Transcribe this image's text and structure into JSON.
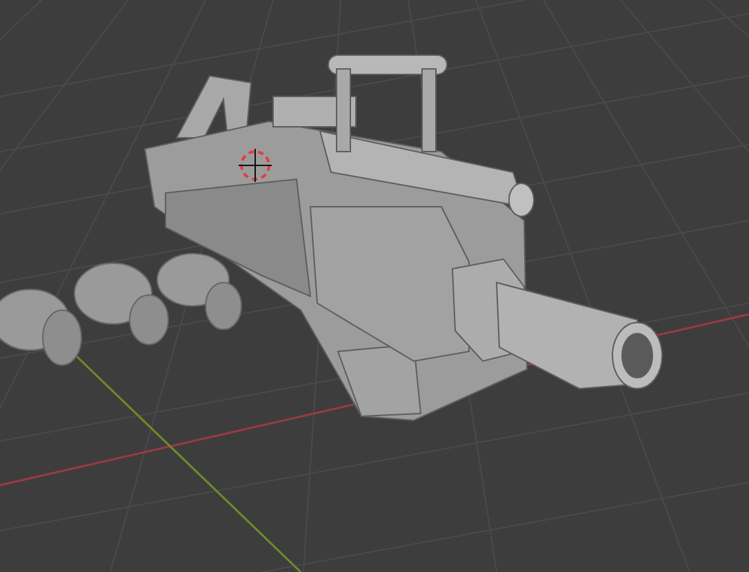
{
  "viewport": {
    "axes": [
      {
        "kind": "x",
        "color": "#9a3a42"
      },
      {
        "kind": "y",
        "color": "#6e8a2a"
      }
    ]
  }
}
